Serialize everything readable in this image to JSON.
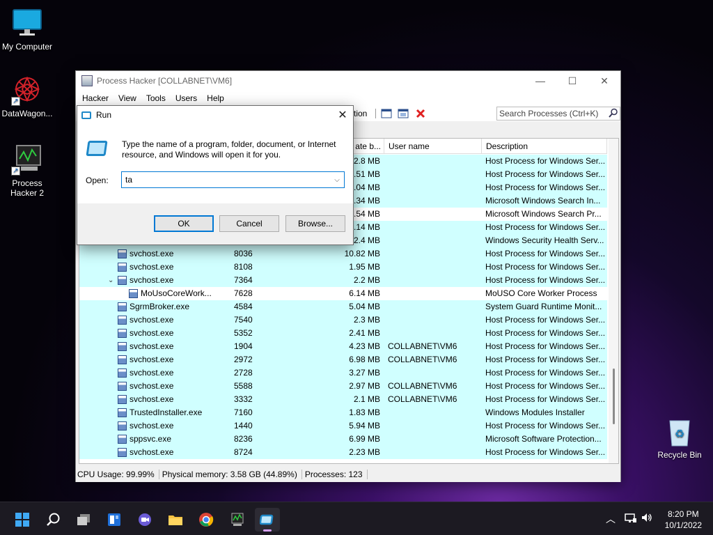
{
  "desktop": {
    "icons": [
      {
        "label": "My Computer"
      },
      {
        "label": "DataWagon..."
      },
      {
        "label": "Process Hacker 2"
      }
    ],
    "recycle_bin": "Recycle Bin"
  },
  "window": {
    "title": "Process Hacker [COLLABNET\\VM6]",
    "menu": [
      "Hacker",
      "View",
      "Tools",
      "Users",
      "Help"
    ],
    "toolbar_partial_text": "tion",
    "search_placeholder": "Search Processes (Ctrl+K)",
    "columns": {
      "private_bytes": "ate b...",
      "user_name": "User name",
      "description": "Description"
    },
    "rows": [
      {
        "name": "",
        "pid": "",
        "mem": "2.8 MB",
        "user": "",
        "desc": "Host Process for Windows Ser...",
        "hl": true
      },
      {
        "name": "",
        "pid": "",
        "mem": ".51 MB",
        "user": "",
        "desc": "Host Process for Windows Ser...",
        "hl": true
      },
      {
        "name": "",
        "pid": "",
        "mem": ".04 MB",
        "user": "",
        "desc": "Host Process for Windows Ser...",
        "hl": true
      },
      {
        "name": "",
        "pid": "",
        "mem": ".34 MB",
        "user": "",
        "desc": "Microsoft Windows Search In...",
        "hl": true
      },
      {
        "name": "",
        "pid": "",
        "mem": ".54 MB",
        "user": "",
        "desc": "Microsoft Windows Search Pr...",
        "hl": false
      },
      {
        "name": "",
        "pid": "",
        "mem": ".14 MB",
        "user": "",
        "desc": "Host Process for Windows Ser...",
        "hl": true
      },
      {
        "name": "",
        "pid": "",
        "mem": "2.4 MB",
        "user": "",
        "desc": "Windows Security Health Serv...",
        "hl": true
      },
      {
        "name": "svchost.exe",
        "pid": "8036",
        "mem": "10.82 MB",
        "user": "",
        "desc": "Host Process for Windows Ser...",
        "hl": true
      },
      {
        "name": "svchost.exe",
        "pid": "8108",
        "mem": "1.95 MB",
        "user": "",
        "desc": "Host Process for Windows Ser...",
        "hl": true
      },
      {
        "name": "svchost.exe",
        "pid": "7364",
        "mem": "2.2 MB",
        "user": "",
        "desc": "Host Process for Windows Ser...",
        "hl": true,
        "expanded": true
      },
      {
        "name": "MoUsoCoreWork...",
        "pid": "7628",
        "mem": "6.14 MB",
        "user": "",
        "desc": "MoUSO Core Worker Process",
        "hl": false,
        "child": true
      },
      {
        "name": "SgrmBroker.exe",
        "pid": "4584",
        "mem": "5.04 MB",
        "user": "",
        "desc": "System Guard Runtime Monit...",
        "hl": true
      },
      {
        "name": "svchost.exe",
        "pid": "7540",
        "mem": "2.3 MB",
        "user": "",
        "desc": "Host Process for Windows Ser...",
        "hl": true
      },
      {
        "name": "svchost.exe",
        "pid": "5352",
        "mem": "2.41 MB",
        "user": "",
        "desc": "Host Process for Windows Ser...",
        "hl": true
      },
      {
        "name": "svchost.exe",
        "pid": "1904",
        "mem": "4.23 MB",
        "user": "COLLABNET\\VM6",
        "desc": "Host Process for Windows Ser...",
        "hl": true
      },
      {
        "name": "svchost.exe",
        "pid": "2972",
        "mem": "6.98 MB",
        "user": "COLLABNET\\VM6",
        "desc": "Host Process for Windows Ser...",
        "hl": true
      },
      {
        "name": "svchost.exe",
        "pid": "2728",
        "mem": "3.27 MB",
        "user": "",
        "desc": "Host Process for Windows Ser...",
        "hl": true
      },
      {
        "name": "svchost.exe",
        "pid": "5588",
        "mem": "2.97 MB",
        "user": "COLLABNET\\VM6",
        "desc": "Host Process for Windows Ser...",
        "hl": true
      },
      {
        "name": "svchost.exe",
        "pid": "3332",
        "mem": "2.1 MB",
        "user": "COLLABNET\\VM6",
        "desc": "Host Process for Windows Ser...",
        "hl": true
      },
      {
        "name": "TrustedInstaller.exe",
        "pid": "7160",
        "mem": "1.83 MB",
        "user": "",
        "desc": "Windows Modules Installer",
        "hl": true
      },
      {
        "name": "svchost.exe",
        "pid": "1440",
        "mem": "5.94 MB",
        "user": "",
        "desc": "Host Process for Windows Ser...",
        "hl": true
      },
      {
        "name": "sppsvc.exe",
        "pid": "8236",
        "mem": "6.99 MB",
        "user": "",
        "desc": "Microsoft Software Protection...",
        "hl": true
      },
      {
        "name": "svchost.exe",
        "pid": "8724",
        "mem": "2.23 MB",
        "user": "",
        "desc": "Host Process for Windows Ser...",
        "hl": true
      }
    ],
    "status": {
      "cpu": "CPU Usage: 99.99%",
      "memory": "Physical memory: 3.58 GB (44.89%)",
      "processes": "Processes: 123"
    }
  },
  "run_dialog": {
    "title": "Run",
    "description": "Type the name of a program, folder, document, or Internet resource, and Windows will open it for you.",
    "open_label": "Open:",
    "open_value": "ta",
    "ok": "OK",
    "cancel": "Cancel",
    "browse": "Browse..."
  },
  "taskbar": {
    "time": "8:20 PM",
    "date": "10/1/2022"
  }
}
